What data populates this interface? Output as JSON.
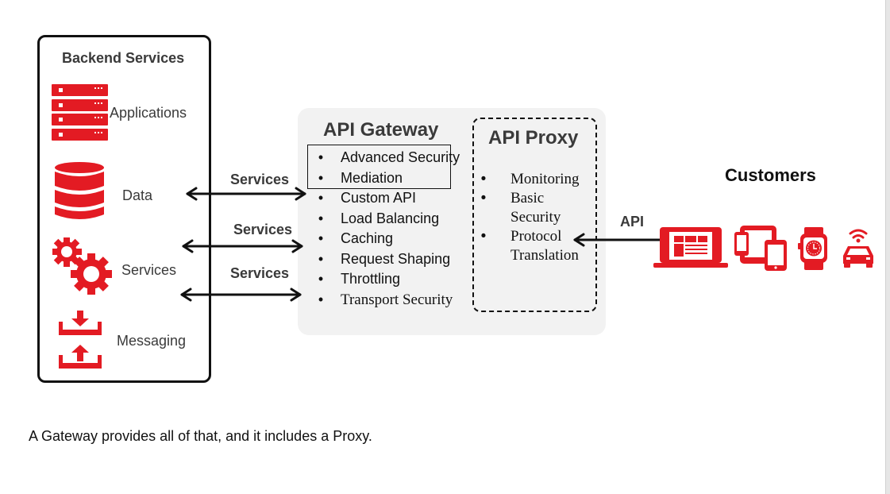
{
  "backend": {
    "title": "Backend Services",
    "items": [
      {
        "label": "Applications",
        "icon": "server-rack-icon"
      },
      {
        "label": "Data",
        "icon": "database-icon"
      },
      {
        "label": "Services",
        "icon": "gears-icon"
      },
      {
        "label": "Messaging",
        "icon": "inbox-upload-download-icon"
      }
    ]
  },
  "connectors": {
    "labels": [
      "Services",
      "Services",
      "Services"
    ],
    "api_label": "API"
  },
  "gateway": {
    "title": "API Gateway",
    "features": [
      "Advanced Security",
      "Mediation",
      "Custom API",
      "Load Balancing",
      "Caching",
      "Request Shaping",
      "Throttling",
      "Transport Security"
    ],
    "highlighted_features": [
      "Advanced Security",
      "Mediation"
    ]
  },
  "proxy": {
    "title": "API Proxy",
    "features": [
      "Monitoring",
      "Basic Security",
      "Protocol Translation"
    ]
  },
  "customers": {
    "title": "Customers",
    "devices": [
      "laptop-icon",
      "tablet-phone-icon",
      "smartwatch-icon",
      "connected-car-icon"
    ]
  },
  "caption": "A Gateway provides all of that, and it includes a Proxy.",
  "colors": {
    "accent_red": "#e31b23",
    "panel_gray": "#f2f2f2",
    "line": "#111111"
  }
}
